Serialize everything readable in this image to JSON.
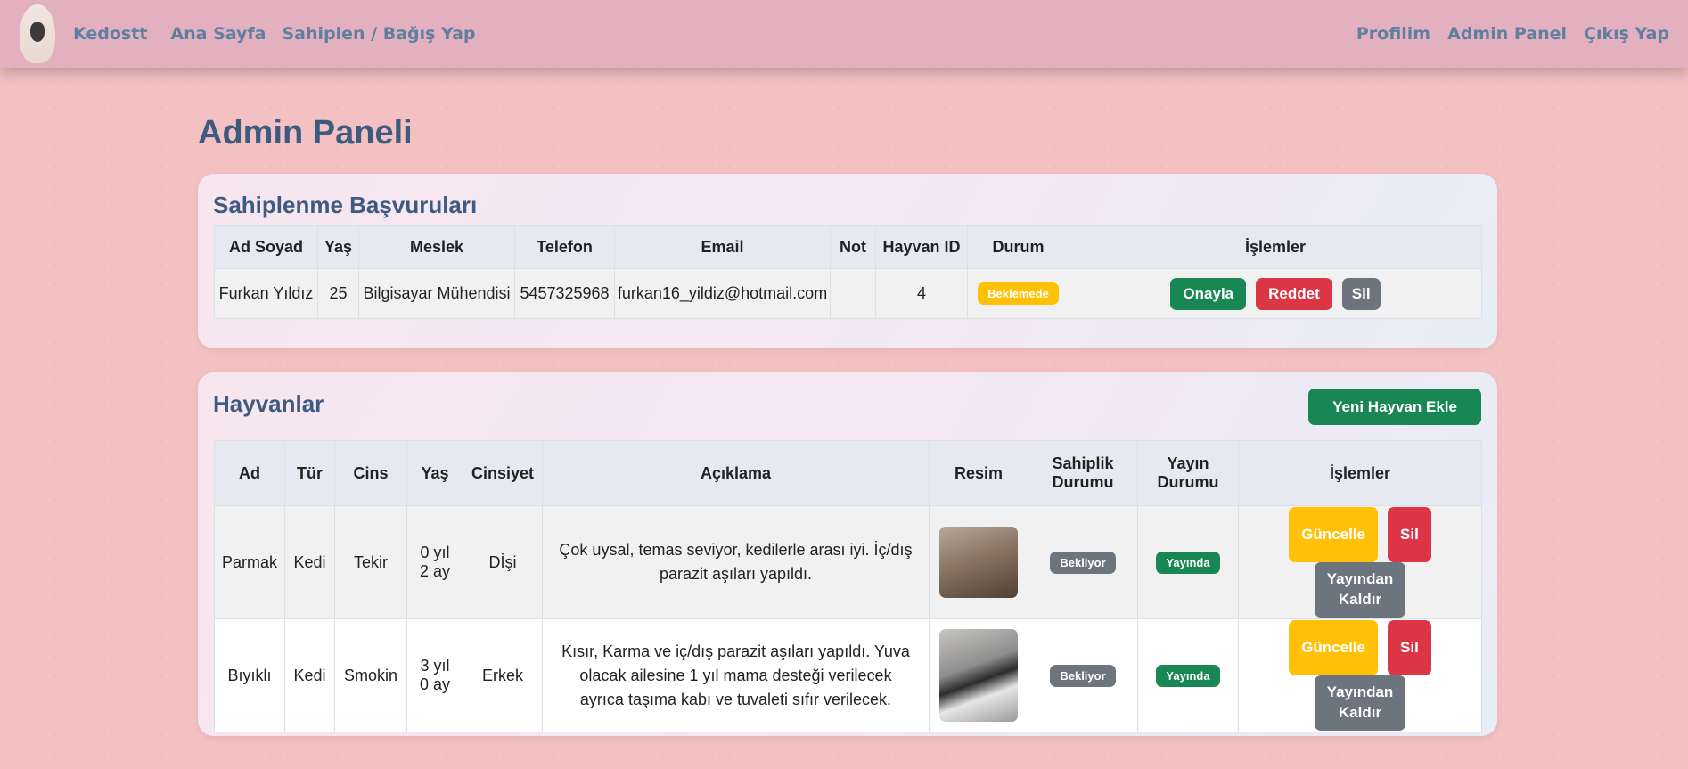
{
  "nav": {
    "brand": "Kedostt",
    "home": "Ana Sayfa",
    "adopt": "Sahiplen / Bağış Yap",
    "profile": "Profilim",
    "admin": "Admin Panel",
    "logout": "Çıkış Yap"
  },
  "page_title": "Admin Paneli",
  "applications": {
    "title": "Sahiplenme Başvuruları",
    "headers": [
      "Ad Soyad",
      "Yaş",
      "Meslek",
      "Telefon",
      "Email",
      "Not",
      "Hayvan ID",
      "Durum",
      "İşlemler"
    ],
    "rows": [
      {
        "name": "Furkan Yıldız",
        "age": "25",
        "job": "Bilgisayar Mühendisi",
        "phone": "5457325968",
        "email": "furkan16_yildiz@hotmail.com",
        "note": "",
        "pet_id": "4",
        "status": "Beklemede",
        "approve": "Onayla",
        "reject": "Reddet",
        "delete": "Sil"
      }
    ]
  },
  "animals": {
    "title": "Hayvanlar",
    "add_button": "Yeni Hayvan Ekle",
    "headers": {
      "name": "Ad",
      "type": "Tür",
      "breed": "Cins",
      "age": "Yaş",
      "gender": "Cinsiyet",
      "desc": "Açıklama",
      "image": "Resim",
      "ownership_1": "Sahiplik",
      "ownership_2": "Durumu",
      "publish_1": "Yayın",
      "publish_2": "Durumu",
      "actions": "İşlemler"
    },
    "rows": [
      {
        "name": "Parmak",
        "type": "Kedi",
        "breed": "Tekir",
        "age_1": "0 yıl",
        "age_2": "2 ay",
        "gender": "Dİşi",
        "desc": "Çok uysal, temas seviyor, kedilerle arası iyi. İç/dış parazit aşıları yapıldı.",
        "ownership": "Bekliyor",
        "publish": "Yayında",
        "update": "Güncelle",
        "delete": "Sil",
        "unpublish_1": "Yayından",
        "unpublish_2": "Kaldır"
      },
      {
        "name": "Bıyıklı",
        "type": "Kedi",
        "breed": "Smokin",
        "age_1": "3 yıl",
        "age_2": "0 ay",
        "gender": "Erkek",
        "desc": "Kısır, Karma ve iç/dış parazit aşıları yapıldı. Yuva olacak ailesine 1 yıl mama desteği verilecek ayrıca taşıma kabı ve tuvaleti sıfır verilecek.",
        "ownership": "Bekliyor",
        "publish": "Yayında",
        "update": "Güncelle",
        "delete": "Sil",
        "unpublish_1": "Yayından",
        "unpublish_2": "Kaldır"
      }
    ]
  }
}
